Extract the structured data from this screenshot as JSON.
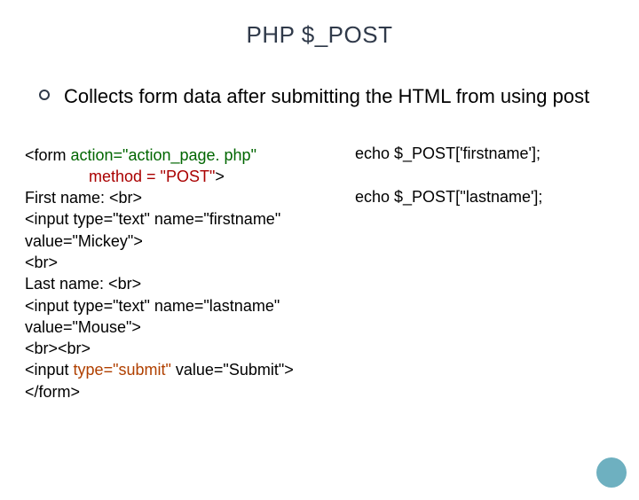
{
  "title": "PHP $_POST",
  "bullet": "Collects form data after submitting the HTML from using post",
  "code": {
    "line1_a": "<form ",
    "line1_b": "action=\"action_page. php\"",
    "line2_a": "method = \"POST\"",
    "line2_b": ">",
    "line3": "First name: <br>",
    "line4": "<input type=\"text\" name=\"firstname\" value=\"Mickey\">",
    "line5": "<br>",
    "line6": "Last name: <br>",
    "line7": "<input type=\"text\" name=\"lastname\" value=\"Mouse\">",
    "line8": "<br><br>",
    "line9_a": "<input ",
    "line9_b": "type=\"submit\"",
    "line9_c": " value=\"Submit\">",
    "line10": "</form>"
  },
  "echo": {
    "first": "echo $_POST['firstname'];",
    "last": "echo $_POST[''lastname'];"
  }
}
